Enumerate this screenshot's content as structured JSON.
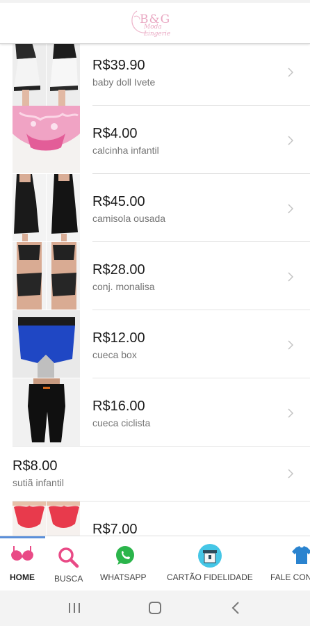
{
  "app": {
    "logo_text": "B&G",
    "logo_script": "Moda Lingerie"
  },
  "products": [
    {
      "price": "R$39.90",
      "name": "baby doll Ivete",
      "has_image": true,
      "image": "babydoll"
    },
    {
      "price": "R$4.00",
      "name": "calcinha infantil",
      "has_image": true,
      "image": "pink-panty"
    },
    {
      "price": "R$45.00",
      "name": "camisola ousada",
      "has_image": true,
      "image": "black-nightgown"
    },
    {
      "price": "R$28.00",
      "name": "conj. monalisa",
      "has_image": true,
      "image": "lace-set"
    },
    {
      "price": "R$12.00",
      "name": "cueca box",
      "has_image": true,
      "image": "boxer"
    },
    {
      "price": "R$16.00",
      "name": "cueca ciclista",
      "has_image": true,
      "image": "cycling-shorts"
    },
    {
      "price": "R$8.00",
      "name": "sutiã infantil",
      "has_image": false
    },
    {
      "price": "R$7.00",
      "name": "",
      "has_image": true,
      "image": "red-panty"
    }
  ],
  "bottom_tabs": [
    {
      "label": "HOME",
      "icon": "bra-icon",
      "active": true
    },
    {
      "label": "BUSCA",
      "icon": "search-icon"
    },
    {
      "label": "WHATSAPP",
      "icon": "whatsapp-icon"
    },
    {
      "label": "CARTÃO FIDELIDADE",
      "icon": "loyalty-card-icon"
    },
    {
      "label": "FALE CON",
      "icon": "contact-shirt-icon"
    }
  ],
  "colors": {
    "accent_pink": "#e94a86",
    "whatsapp_green": "#2bb54b",
    "active_tab": "#5b8fd9"
  },
  "system_nav": {
    "recents": "recents-icon",
    "home": "home-icon",
    "back": "back-icon"
  }
}
